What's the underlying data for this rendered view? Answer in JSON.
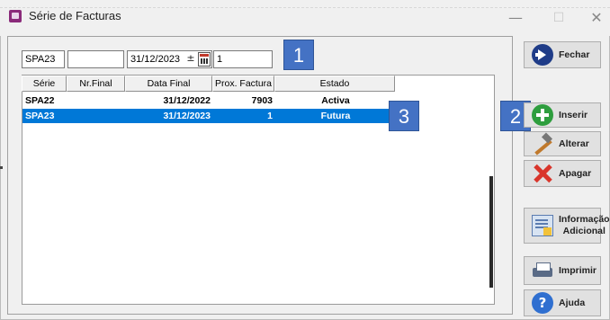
{
  "window": {
    "title": "Série de Facturas",
    "minimize_label": "—",
    "maximize_label": "☐",
    "close_label": "✕"
  },
  "filters": {
    "serie_value": "SPA23",
    "nr_final_value": "",
    "date_value": "31/12/2023",
    "date_spin_glyph": "±",
    "prox_factura_value": "1"
  },
  "grid": {
    "columns": [
      "Série",
      "Nr.Final",
      "Data Final",
      "Prox. Factura",
      "Estado"
    ],
    "rows": [
      {
        "serie": "SPA22",
        "nr_final": "",
        "data_final": "31/12/2022",
        "prox_factura": "7903",
        "estado": "Activa",
        "selected": false
      },
      {
        "serie": "SPA23",
        "nr_final": "",
        "data_final": "31/12/2023",
        "prox_factura": "1",
        "estado": "Futura",
        "selected": true
      }
    ]
  },
  "annotations": {
    "badge_1": "1",
    "badge_2": "2",
    "badge_3": "3",
    "badge_color": "#4472c4"
  },
  "buttons": {
    "fechar": "Fechar",
    "inserir": "Inserir",
    "alterar": "Alterar",
    "apagar": "Apagar",
    "info_line1": "Informação",
    "info_line2": "Adicional",
    "imprimir": "Imprimir",
    "ajuda": "Ajuda",
    "ajuda_icon_glyph": "?"
  },
  "icons": {
    "app": "app-icon",
    "fechar": "exit-arrow-icon",
    "inserir": "plus-circle-icon",
    "alterar": "hammer-icon",
    "apagar": "red-x-icon",
    "info": "document-info-icon",
    "imprimir": "printer-icon",
    "ajuda": "help-icon",
    "calendar": "calendar-icon"
  },
  "colors": {
    "selection": "#0078d7",
    "window_bg": "#f0f0f0"
  }
}
